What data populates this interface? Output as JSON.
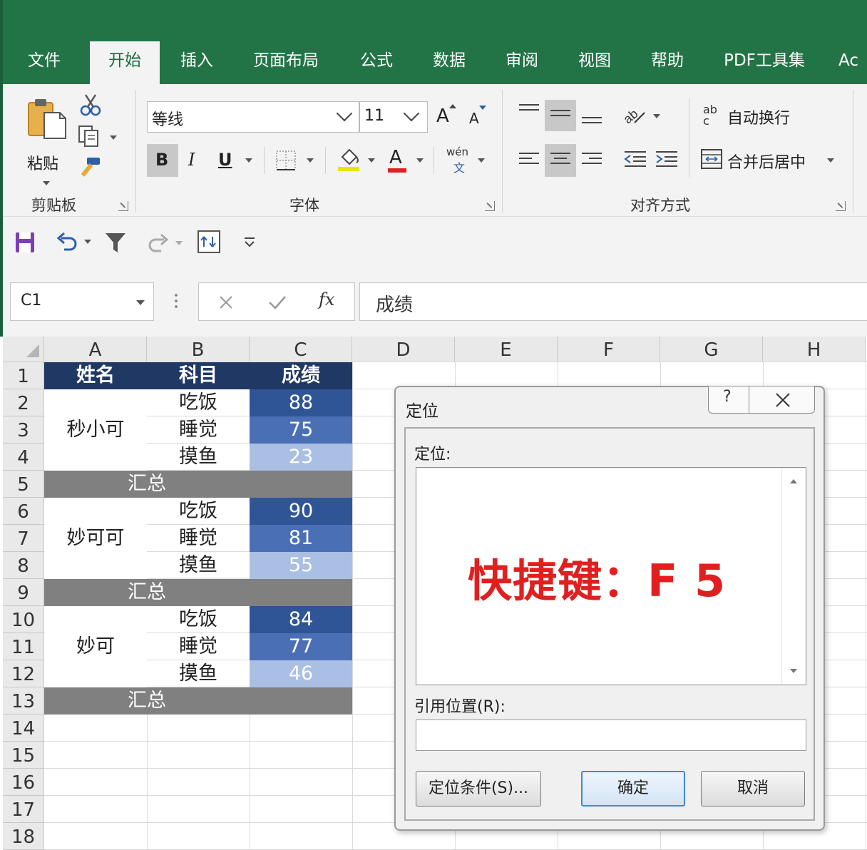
{
  "ribbon_tabs": [
    "文件",
    "开始",
    "插入",
    "页面布局",
    "公式",
    "数据",
    "审阅",
    "视图",
    "帮助",
    "PDF工具集",
    "Ac"
  ],
  "active_tab": "开始",
  "clipboard": {
    "paste_label": "粘贴",
    "group_label": "剪贴板"
  },
  "font": {
    "name": "等线",
    "size": "11",
    "group_label": "字体",
    "bold": "B",
    "italic": "I",
    "underline": "U",
    "grow": "A",
    "shrink": "A",
    "font_color": "A",
    "phonetic_top": "wén",
    "phonetic_bottom": "文"
  },
  "alignment": {
    "wrap_label": "自动换行",
    "merge_label": "合并后居中",
    "group_label": "对齐方式",
    "wrap_icon": "ab",
    "wrap_icon2": "c"
  },
  "name_box": "C1",
  "formula_bar": {
    "fx": "fx",
    "content": "成绩"
  },
  "columns": [
    "A",
    "B",
    "C",
    "D",
    "E",
    "F",
    "G",
    "H"
  ],
  "rows": [
    "1",
    "2",
    "3",
    "4",
    "5",
    "6",
    "7",
    "8",
    "9",
    "10",
    "11",
    "12",
    "13",
    "14",
    "15",
    "16",
    "17",
    "18"
  ],
  "table": {
    "headers": [
      "姓名",
      "科目",
      "成绩"
    ],
    "groups": [
      {
        "name": "秒小可",
        "items": [
          {
            "subject": "吃饭",
            "score": "88"
          },
          {
            "subject": "睡觉",
            "score": "75"
          },
          {
            "subject": "摸鱼",
            "score": "23"
          }
        ],
        "summary": "汇总"
      },
      {
        "name": "妙可可",
        "items": [
          {
            "subject": "吃饭",
            "score": "90"
          },
          {
            "subject": "睡觉",
            "score": "81"
          },
          {
            "subject": "摸鱼",
            "score": "55"
          }
        ],
        "summary": "汇总"
      },
      {
        "name": "妙可",
        "items": [
          {
            "subject": "吃饭",
            "score": "84"
          },
          {
            "subject": "睡觉",
            "score": "77"
          },
          {
            "subject": "摸鱼",
            "score": "46"
          }
        ],
        "summary": "汇总"
      }
    ]
  },
  "dialog": {
    "title": "定位",
    "help": "?",
    "list_label": "定位:",
    "overlay_text": "快捷键：F 5",
    "reference_label": "引用位置(R):",
    "reference_value": "",
    "special_button": "定位条件(S)...",
    "ok_button": "确定",
    "cancel_button": "取消"
  },
  "colors": {
    "ribbon_green": "#227447",
    "header_navy": "#203864",
    "summary_gray": "#808080",
    "score_dark": "#2f5597",
    "score_mid": "#4a6fb5",
    "score_light": "#a9bfe3",
    "shortcut_red": "#e02020"
  }
}
